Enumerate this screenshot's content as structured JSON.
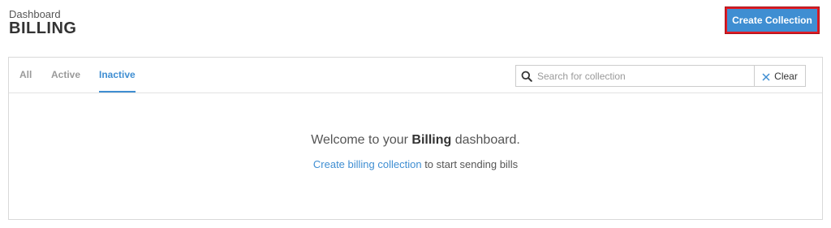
{
  "header": {
    "breadcrumb": "Dashboard",
    "title": "BILLING",
    "create_button_label": "Create Collection"
  },
  "tabs": [
    {
      "label": "All",
      "active": false
    },
    {
      "label": "Active",
      "active": false
    },
    {
      "label": "Inactive",
      "active": true
    }
  ],
  "search": {
    "placeholder": "Search for collection",
    "value": "",
    "icon": "search-icon"
  },
  "clear_button": {
    "label": "Clear",
    "icon": "close-icon"
  },
  "empty_state": {
    "welcome_prefix": "Welcome to your ",
    "welcome_bold": "Billing",
    "welcome_suffix": " dashboard.",
    "link_text": "Create billing collection",
    "link_suffix": " to start sending bills"
  },
  "colors": {
    "accent": "#3f8ed2",
    "highlight_border": "#e01b24"
  }
}
